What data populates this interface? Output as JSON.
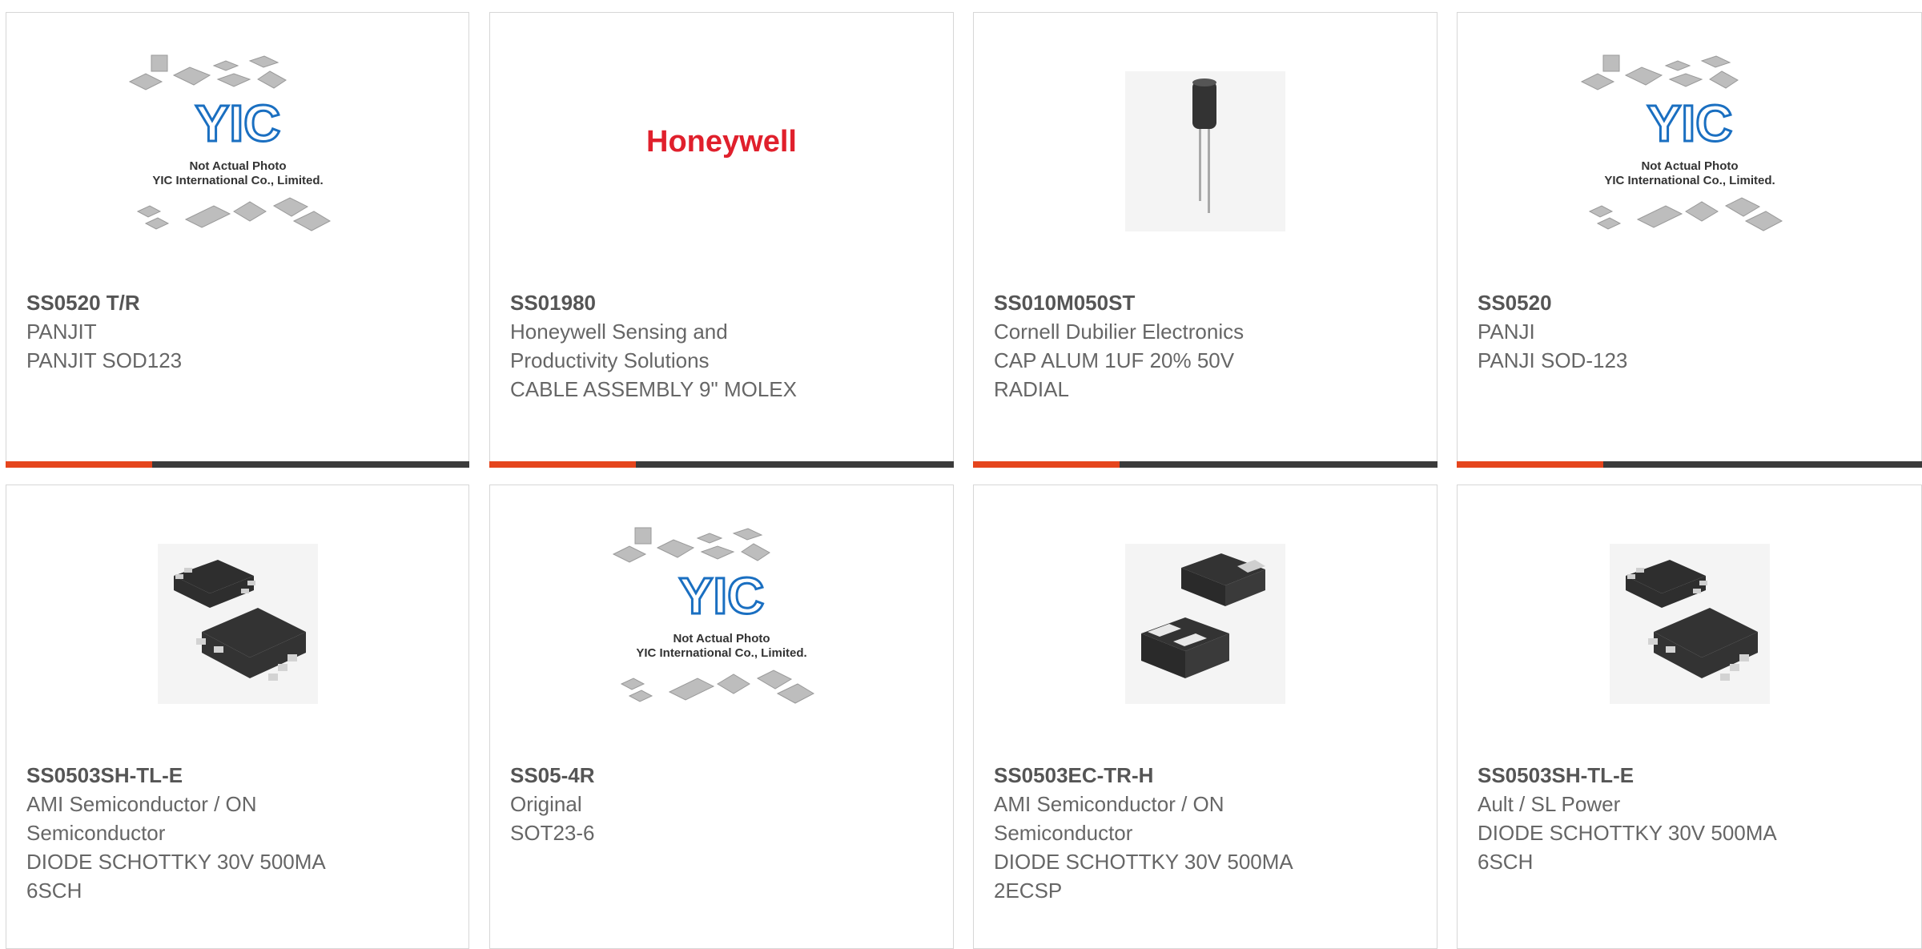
{
  "colors": {
    "accent": "#e5451d",
    "bar_dark": "#3b3b3b",
    "honeywell_red": "#e0202c",
    "yic_blue": "#1a6fc1"
  },
  "placeholder": {
    "line1": "Not Actual Photo",
    "line2": "YIC International Co., Limited.",
    "logo": "YIC"
  },
  "cards": [
    {
      "part": "SS0520 T/R",
      "lines": [
        "PANJIT",
        "PANJIT SOD123"
      ],
      "image": "yic-placeholder-image"
    },
    {
      "part": "SS01980",
      "lines": [
        "Honeywell Sensing and",
        "Productivity Solutions",
        "CABLE ASSEMBLY 9\" MOLEX"
      ],
      "image": "honeywell-logo",
      "logo_text": "Honeywell"
    },
    {
      "part": "SS010M050ST",
      "lines": [
        "Cornell Dubilier Electronics",
        "CAP ALUM 1UF 20% 50V",
        "RADIAL"
      ],
      "image": "capacitor-image"
    },
    {
      "part": "SS0520",
      "lines": [
        "PANJI",
        "PANJI SOD-123"
      ],
      "image": "yic-placeholder-image"
    },
    {
      "part": "SS0503SH-TL-E",
      "lines": [
        "AMI Semiconductor / ON",
        "Semiconductor",
        "DIODE SCHOTTKY 30V 500MA",
        "6SCH"
      ],
      "image": "smd-6pin-image"
    },
    {
      "part": "SS05-4R",
      "lines": [
        "Original",
        "SOT23-6"
      ],
      "image": "yic-placeholder-image"
    },
    {
      "part": "SS0503EC-TR-H",
      "lines": [
        "AMI Semiconductor / ON",
        "Semiconductor",
        "DIODE SCHOTTKY 30V 500MA",
        "2ECSP"
      ],
      "image": "smd-2pin-image"
    },
    {
      "part": "SS0503SH-TL-E",
      "lines": [
        "Ault / SL Power",
        "DIODE SCHOTTKY 30V 500MA",
        "6SCH"
      ],
      "image": "smd-6pin-image"
    }
  ]
}
